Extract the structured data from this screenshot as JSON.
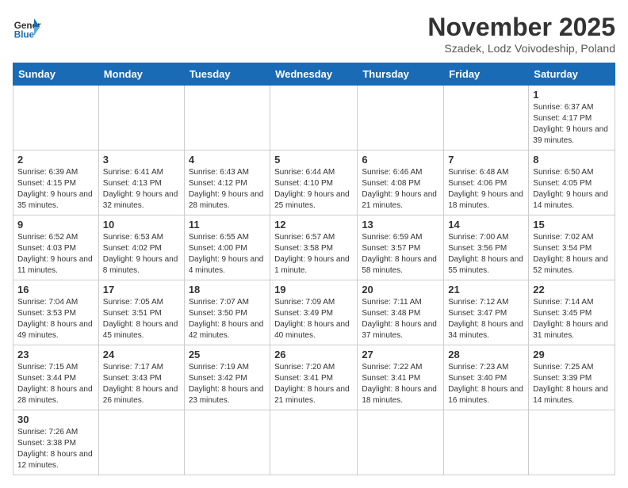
{
  "header": {
    "logo_general": "General",
    "logo_blue": "Blue",
    "month_title": "November 2025",
    "subtitle": "Szadek, Lodz Voivodeship, Poland"
  },
  "weekdays": [
    "Sunday",
    "Monday",
    "Tuesday",
    "Wednesday",
    "Thursday",
    "Friday",
    "Saturday"
  ],
  "weeks": [
    [
      {
        "day": "",
        "info": ""
      },
      {
        "day": "",
        "info": ""
      },
      {
        "day": "",
        "info": ""
      },
      {
        "day": "",
        "info": ""
      },
      {
        "day": "",
        "info": ""
      },
      {
        "day": "",
        "info": ""
      },
      {
        "day": "1",
        "info": "Sunrise: 6:37 AM\nSunset: 4:17 PM\nDaylight: 9 hours and 39 minutes."
      }
    ],
    [
      {
        "day": "2",
        "info": "Sunrise: 6:39 AM\nSunset: 4:15 PM\nDaylight: 9 hours and 35 minutes."
      },
      {
        "day": "3",
        "info": "Sunrise: 6:41 AM\nSunset: 4:13 PM\nDaylight: 9 hours and 32 minutes."
      },
      {
        "day": "4",
        "info": "Sunrise: 6:43 AM\nSunset: 4:12 PM\nDaylight: 9 hours and 28 minutes."
      },
      {
        "day": "5",
        "info": "Sunrise: 6:44 AM\nSunset: 4:10 PM\nDaylight: 9 hours and 25 minutes."
      },
      {
        "day": "6",
        "info": "Sunrise: 6:46 AM\nSunset: 4:08 PM\nDaylight: 9 hours and 21 minutes."
      },
      {
        "day": "7",
        "info": "Sunrise: 6:48 AM\nSunset: 4:06 PM\nDaylight: 9 hours and 18 minutes."
      },
      {
        "day": "8",
        "info": "Sunrise: 6:50 AM\nSunset: 4:05 PM\nDaylight: 9 hours and 14 minutes."
      }
    ],
    [
      {
        "day": "9",
        "info": "Sunrise: 6:52 AM\nSunset: 4:03 PM\nDaylight: 9 hours and 11 minutes."
      },
      {
        "day": "10",
        "info": "Sunrise: 6:53 AM\nSunset: 4:02 PM\nDaylight: 9 hours and 8 minutes."
      },
      {
        "day": "11",
        "info": "Sunrise: 6:55 AM\nSunset: 4:00 PM\nDaylight: 9 hours and 4 minutes."
      },
      {
        "day": "12",
        "info": "Sunrise: 6:57 AM\nSunset: 3:58 PM\nDaylight: 9 hours and 1 minute."
      },
      {
        "day": "13",
        "info": "Sunrise: 6:59 AM\nSunset: 3:57 PM\nDaylight: 8 hours and 58 minutes."
      },
      {
        "day": "14",
        "info": "Sunrise: 7:00 AM\nSunset: 3:56 PM\nDaylight: 8 hours and 55 minutes."
      },
      {
        "day": "15",
        "info": "Sunrise: 7:02 AM\nSunset: 3:54 PM\nDaylight: 8 hours and 52 minutes."
      }
    ],
    [
      {
        "day": "16",
        "info": "Sunrise: 7:04 AM\nSunset: 3:53 PM\nDaylight: 8 hours and 49 minutes."
      },
      {
        "day": "17",
        "info": "Sunrise: 7:05 AM\nSunset: 3:51 PM\nDaylight: 8 hours and 45 minutes."
      },
      {
        "day": "18",
        "info": "Sunrise: 7:07 AM\nSunset: 3:50 PM\nDaylight: 8 hours and 42 minutes."
      },
      {
        "day": "19",
        "info": "Sunrise: 7:09 AM\nSunset: 3:49 PM\nDaylight: 8 hours and 40 minutes."
      },
      {
        "day": "20",
        "info": "Sunrise: 7:11 AM\nSunset: 3:48 PM\nDaylight: 8 hours and 37 minutes."
      },
      {
        "day": "21",
        "info": "Sunrise: 7:12 AM\nSunset: 3:47 PM\nDaylight: 8 hours and 34 minutes."
      },
      {
        "day": "22",
        "info": "Sunrise: 7:14 AM\nSunset: 3:45 PM\nDaylight: 8 hours and 31 minutes."
      }
    ],
    [
      {
        "day": "23",
        "info": "Sunrise: 7:15 AM\nSunset: 3:44 PM\nDaylight: 8 hours and 28 minutes."
      },
      {
        "day": "24",
        "info": "Sunrise: 7:17 AM\nSunset: 3:43 PM\nDaylight: 8 hours and 26 minutes."
      },
      {
        "day": "25",
        "info": "Sunrise: 7:19 AM\nSunset: 3:42 PM\nDaylight: 8 hours and 23 minutes."
      },
      {
        "day": "26",
        "info": "Sunrise: 7:20 AM\nSunset: 3:41 PM\nDaylight: 8 hours and 21 minutes."
      },
      {
        "day": "27",
        "info": "Sunrise: 7:22 AM\nSunset: 3:41 PM\nDaylight: 8 hours and 18 minutes."
      },
      {
        "day": "28",
        "info": "Sunrise: 7:23 AM\nSunset: 3:40 PM\nDaylight: 8 hours and 16 minutes."
      },
      {
        "day": "29",
        "info": "Sunrise: 7:25 AM\nSunset: 3:39 PM\nDaylight: 8 hours and 14 minutes."
      }
    ],
    [
      {
        "day": "30",
        "info": "Sunrise: 7:26 AM\nSunset: 3:38 PM\nDaylight: 8 hours and 12 minutes."
      },
      {
        "day": "",
        "info": ""
      },
      {
        "day": "",
        "info": ""
      },
      {
        "day": "",
        "info": ""
      },
      {
        "day": "",
        "info": ""
      },
      {
        "day": "",
        "info": ""
      },
      {
        "day": "",
        "info": ""
      }
    ]
  ]
}
